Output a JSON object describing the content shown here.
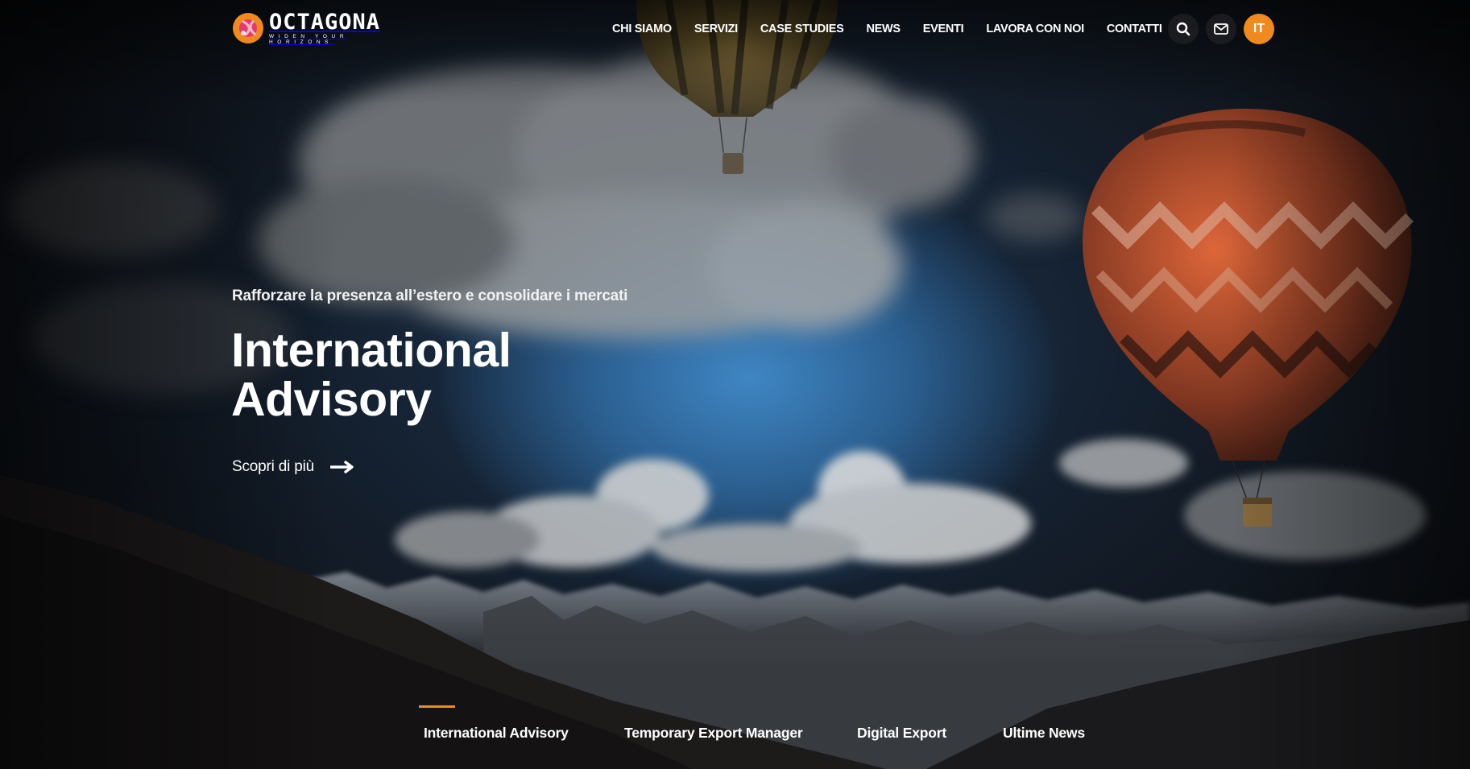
{
  "brand": {
    "name": "OCTAGONA",
    "tagline": "WIDEN YOUR HORIZONS",
    "accent_color": "#f08a1c"
  },
  "nav": {
    "items": [
      "CHI SIAMO",
      "SERVIZI",
      "CASE STUDIES",
      "NEWS",
      "EVENTI",
      "LAVORA CON NOI",
      "CONTATTI"
    ],
    "search_icon": "search-icon",
    "mail_icon": "mail-icon",
    "language": "IT"
  },
  "hero": {
    "eyebrow": "Rafforzare la presenza all’estero e consolidare i mercati",
    "title_line1": "International",
    "title_line2": "Advisory",
    "cta_label": "Scopri di più",
    "cta_icon": "arrow-right-icon"
  },
  "tabs": {
    "items": [
      "International Advisory",
      "Temporary Export Manager",
      "Digital Export",
      "Ultime News"
    ],
    "active_index": 0
  }
}
